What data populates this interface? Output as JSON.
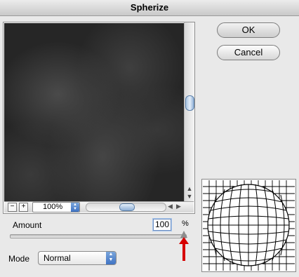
{
  "window": {
    "title": "Spherize"
  },
  "buttons": {
    "ok": "OK",
    "cancel": "Cancel"
  },
  "preview": {
    "zoom_value": "100%",
    "zoom_out": "−",
    "zoom_in": "+"
  },
  "amount": {
    "label": "Amount",
    "value": "100",
    "unit": "%",
    "slider_fraction": 1.0
  },
  "mode": {
    "label": "Mode",
    "selected": "Normal"
  },
  "colors": {
    "annotation_arrow": "#d60000",
    "focus_ring": "#a8c6ec"
  },
  "icons": {
    "scroll_up": "chevron-up-icon",
    "scroll_down": "chevron-down-icon",
    "scroll_left": "chevron-left-icon",
    "scroll_right": "chevron-right-icon",
    "zoom_select": "updown-arrows-icon",
    "mode_select": "updown-arrows-icon"
  }
}
